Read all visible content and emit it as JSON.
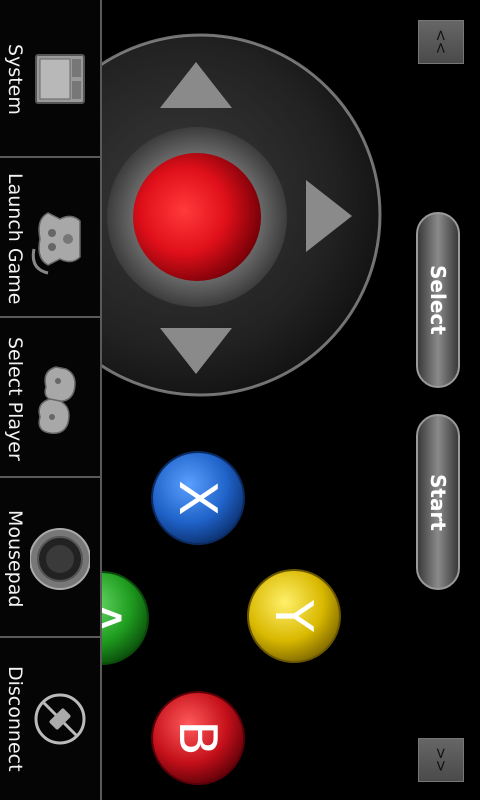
{
  "sidebar": {
    "items": [
      {
        "label": "System",
        "icon": "system-icon"
      },
      {
        "label": "Launch Game",
        "icon": "launch-game-icon"
      },
      {
        "label": "Select Player",
        "icon": "select-player-icon"
      },
      {
        "label": "Mousepad",
        "icon": "mousepad-icon"
      },
      {
        "label": "Disconnect",
        "icon": "disconnect-icon"
      }
    ]
  },
  "controls": {
    "collapse_top_label": "<<",
    "collapse_bottom_label": ">>",
    "select_label": "Select",
    "start_label": "Start",
    "button_x": "X",
    "button_y": "Y",
    "button_b": "B",
    "button_a": "A"
  },
  "colors": {
    "red_center": "#e0101a",
    "blue_x": "#1f62c8",
    "yellow_y": "#d9b800",
    "red_b": "#c4101a",
    "green_a": "#1f9d1f"
  }
}
